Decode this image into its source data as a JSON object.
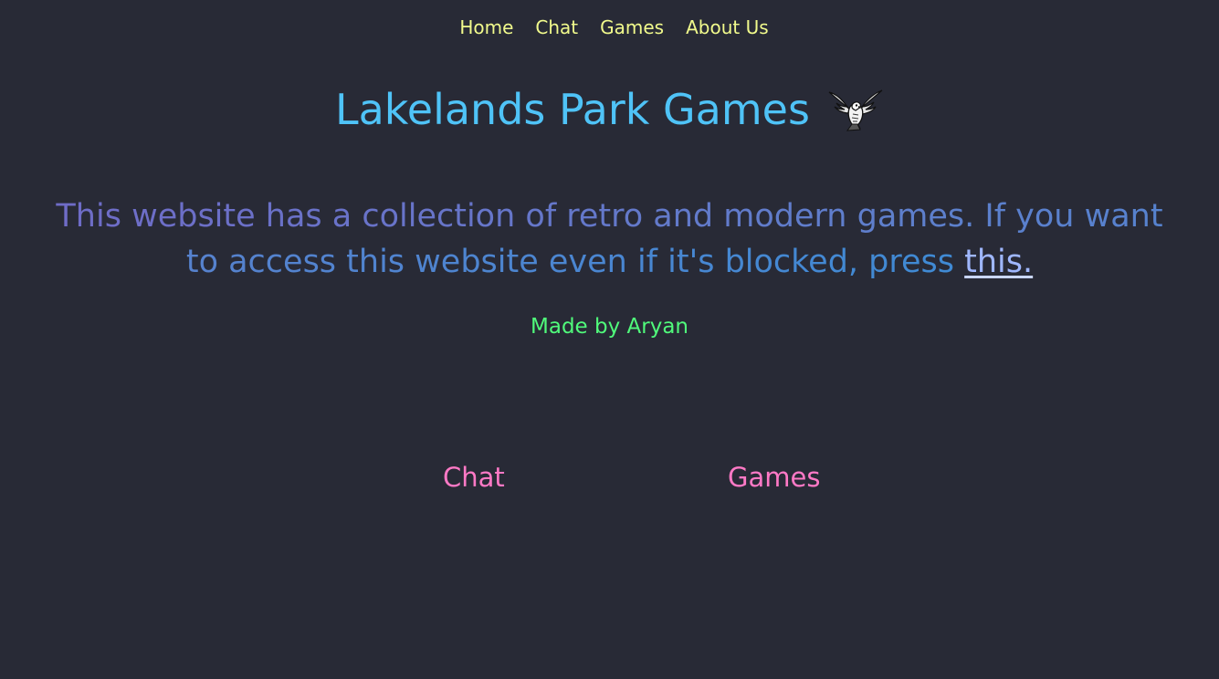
{
  "nav": {
    "items": [
      {
        "label": "Home"
      },
      {
        "label": "Chat"
      },
      {
        "label": "Games"
      },
      {
        "label": "About Us"
      }
    ]
  },
  "header": {
    "title": "Lakelands Park Games",
    "logo_icon": "hawk-icon"
  },
  "intro": {
    "text": "This website has a collection of retro and modern games. If you want to access this website even if it's blocked, press ",
    "link_label": "this."
  },
  "credit": "Made by Aryan",
  "links": {
    "chat_label": "Chat",
    "games_label": "Games"
  },
  "colors": {
    "background": "#282a36",
    "nav": "#f1fa8c",
    "title": "#4fc3f7",
    "credit": "#50fa7b",
    "big_links": "#ff79c6"
  }
}
